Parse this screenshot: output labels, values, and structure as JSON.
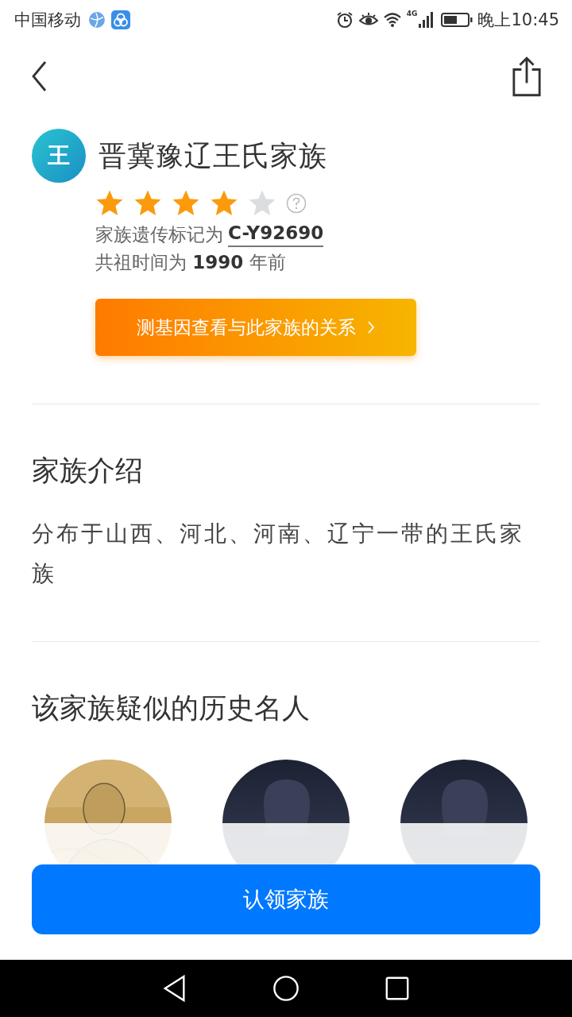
{
  "status_bar": {
    "carrier": "中国移动",
    "network": "4G",
    "time": "晚上10:45"
  },
  "family": {
    "avatar_text": "王",
    "name": "晋冀豫辽王氏家族",
    "stars": 4,
    "marker_label": "家族遗传标记为",
    "marker": "C-Y92690",
    "ancestor_text": "共祖时间为 **1990** 年前",
    "test_button": "测基因查看与此家族的关系"
  },
  "intro": {
    "title": "家族介绍",
    "text": "分布于山西、河北、河南、辽宁一带的王氏家族"
  },
  "famous": {
    "title": "该家族疑似的历史名人",
    "people": [
      {
        "kind": "picture"
      },
      {
        "kind": "silhouette"
      },
      {
        "kind": "silhouette"
      }
    ]
  },
  "claim_button": "认领家族"
}
